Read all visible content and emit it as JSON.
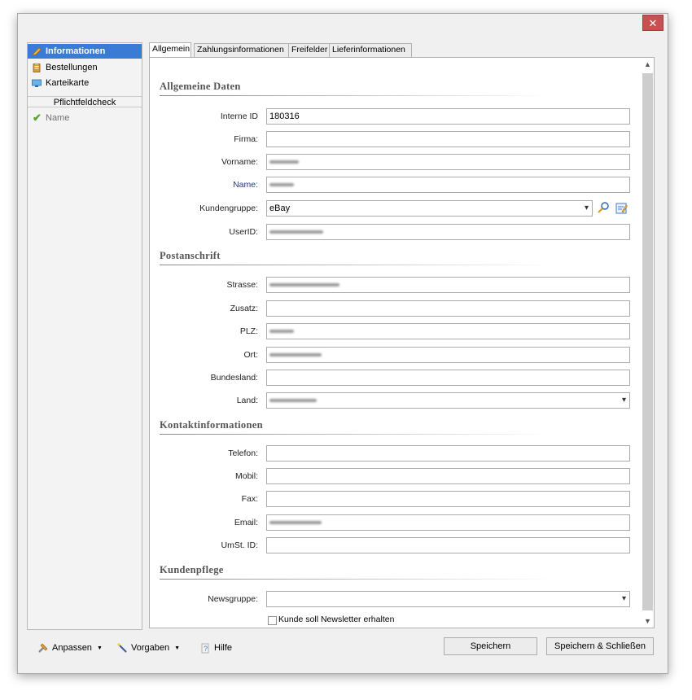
{
  "window": {
    "close_glyph": "✕"
  },
  "sidebar": {
    "items": [
      {
        "label": "Informationen",
        "icon": "pencil-icon",
        "active": true
      },
      {
        "label": "Bestellungen",
        "icon": "clipboard-icon",
        "active": false
      },
      {
        "label": "Karteikarte",
        "icon": "card-icon",
        "active": false
      }
    ],
    "pflicht_header": "Pflichtfeldcheck",
    "pflicht_items": [
      {
        "label": "Name",
        "icon": "checkmark-icon"
      }
    ]
  },
  "tabs": [
    {
      "label": "Allgemein",
      "active": true
    },
    {
      "label": "Zahlungsinformationen",
      "active": false
    },
    {
      "label": "Freifelder",
      "active": false
    },
    {
      "label": "Lieferinformationen",
      "active": false
    }
  ],
  "sections": {
    "allgemeine": "Allgemeine Daten",
    "post": "Postanschrift",
    "kontakt": "Kontaktinformationen",
    "pflege": "Kundenpflege"
  },
  "fields": {
    "interne_id": {
      "label": "Interne ID",
      "value": "180316"
    },
    "firma": {
      "label": "Firma:",
      "value": ""
    },
    "vorname": {
      "label": "Vorname:",
      "value": ""
    },
    "name": {
      "label": "Name:",
      "value": ""
    },
    "kundengruppe": {
      "label": "Kundengruppe:",
      "value": "eBay"
    },
    "userid": {
      "label": "UserID:",
      "value": ""
    },
    "strasse": {
      "label": "Strasse:",
      "value": ""
    },
    "zusatz": {
      "label": "Zusatz:",
      "value": ""
    },
    "plz": {
      "label": "PLZ:",
      "value": ""
    },
    "ort": {
      "label": "Ort:",
      "value": ""
    },
    "bundesland": {
      "label": "Bundesland:",
      "value": ""
    },
    "land": {
      "label": "Land:",
      "value": ""
    },
    "telefon": {
      "label": "Telefon:",
      "value": ""
    },
    "mobil": {
      "label": "Mobil:",
      "value": ""
    },
    "fax": {
      "label": "Fax:",
      "value": ""
    },
    "email": {
      "label": "Email:",
      "value": ""
    },
    "ust": {
      "label": "UmSt. ID:",
      "value": ""
    },
    "newsgruppe": {
      "label": "Newsgruppe:",
      "value": ""
    }
  },
  "newsletter_checkbox": {
    "label": "Kunde soll Newsletter erhalten",
    "checked": false
  },
  "toolbar": {
    "anpassen": "Anpassen",
    "vorgaben": "Vorgaben",
    "hilfe": "Hilfe",
    "speichern": "Speichern",
    "speichern_schliessen": "Speichern & Schließen"
  },
  "colors": {
    "accent": "#3a7bd5",
    "close": "#c75050",
    "check": "#58a52a"
  }
}
